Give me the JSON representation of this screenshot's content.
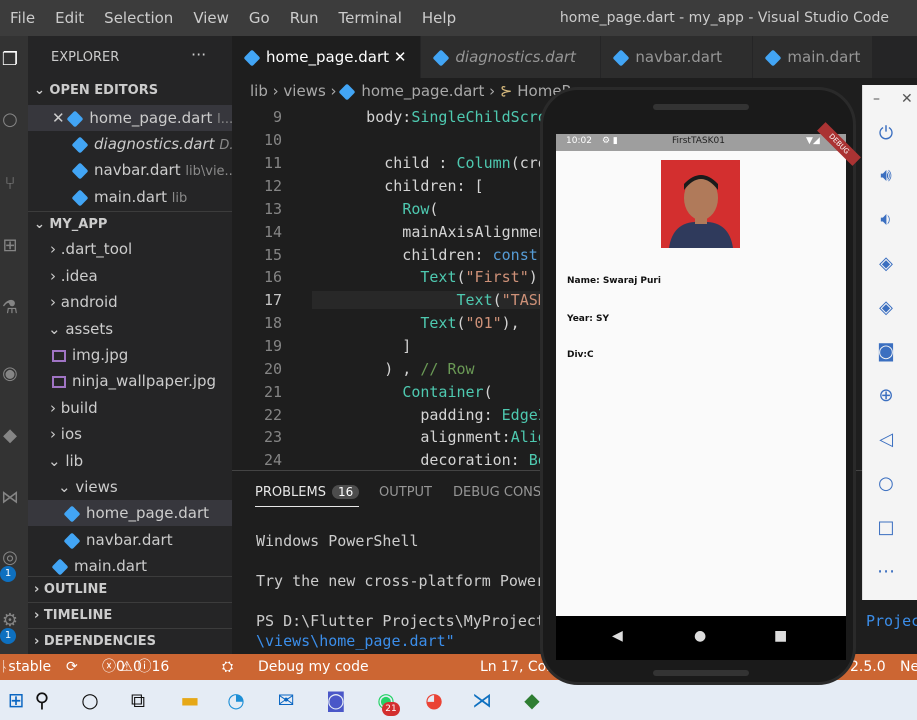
{
  "titlebar": {
    "menu": [
      "File",
      "Edit",
      "Selection",
      "View",
      "Go",
      "Run",
      "Terminal",
      "Help"
    ],
    "window_title": "home_page.dart - my_app - Visual Studio Code"
  },
  "activity": {
    "badge_source_control": "1",
    "badge_accounts": "1"
  },
  "sidebar": {
    "explorer_title": "EXPLORER",
    "more": "···",
    "open_editors_title": "OPEN EDITORS",
    "open_editors": [
      {
        "name": "home_page.dart",
        "hint": "l..."
      },
      {
        "name": "diagnostics.dart",
        "hint": "D..."
      },
      {
        "name": "navbar.dart",
        "hint": "lib\\vie..."
      },
      {
        "name": "main.dart",
        "hint": "lib"
      }
    ],
    "project_title": "MY_APP",
    "tree": [
      ".dart_tool",
      ".idea",
      "android",
      "assets",
      "img.jpg",
      "ninja_wallpaper.jpg",
      "build",
      "ios",
      "lib",
      "views",
      "home_page.dart",
      "navbar.dart",
      "main.dart"
    ],
    "outline": "OUTLINE",
    "timeline": "TIMELINE",
    "dependencies": "DEPENDENCIES"
  },
  "tabs": [
    "home_page.dart",
    "diagnostics.dart",
    "navbar.dart",
    "main.dart"
  ],
  "tab_close": "✕",
  "breadcrumb": [
    "lib",
    "views",
    "home_page.dart",
    "HomeP"
  ],
  "editor": {
    "lines": [
      "9",
      "10",
      "11",
      "12",
      "13",
      "14",
      "15",
      "16",
      "17",
      "18",
      "19",
      "20",
      "21",
      "22",
      "23",
      "24"
    ],
    "current_line": "17"
  },
  "panel": {
    "tabs": [
      "PROBLEMS",
      "OUTPUT",
      "DEBUG CONSO"
    ],
    "problems_count": "16",
    "terminal": [
      "Windows PowerShell",
      "Try the new cross-platform Power",
      "PS D:\\Flutter Projects\\MyProject",
      "\\views\\home_page.dart\""
    ],
    "right_fragment": "Projec"
  },
  "status": {
    "branch": "stable",
    "errors": "0",
    "warnings": "0",
    "infos": "16",
    "debug": "Debug my code",
    "position": "Ln 17, Col",
    "version": "2.5.0",
    "ne": "Ne"
  },
  "phone": {
    "time": "10:02",
    "app_title": "FirstTASK01",
    "debug_ribbon": "DEBUG",
    "name": "Name: Swaraj Puri",
    "year": "Year: SY",
    "div": "Div:C"
  },
  "taskbar": {
    "whatsapp_badge": "21"
  },
  "colors": {
    "status_bar": "#cc6633",
    "accent": "#0e70c0",
    "photo_bg": "#d32f2f"
  }
}
